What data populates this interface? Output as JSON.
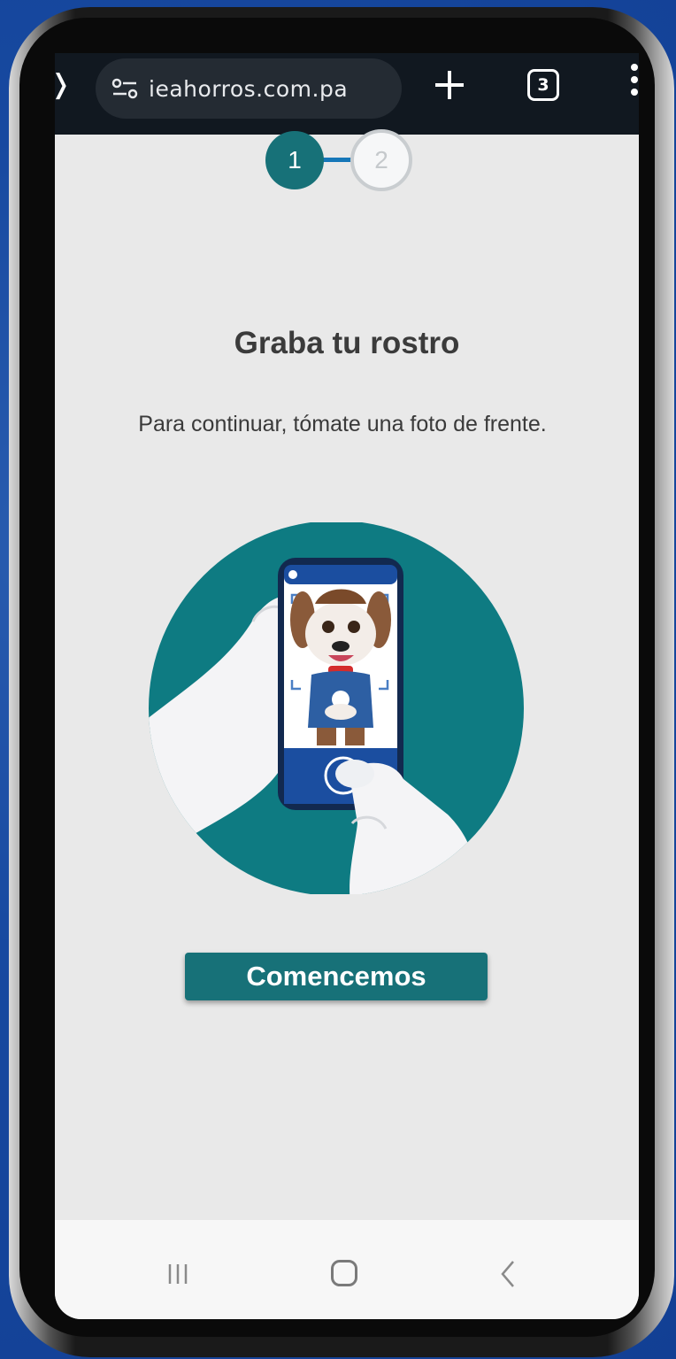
{
  "browser": {
    "url": "ieahorros.com.pa",
    "tab_count": "3",
    "icons": [
      "home-icon",
      "site-settings-icon",
      "plus-icon",
      "tab-switcher-icon",
      "more-vert-icon"
    ]
  },
  "stepper": {
    "steps": [
      "1",
      "2"
    ],
    "active_step": "1",
    "active_color": "#177178"
  },
  "page": {
    "title": "Graba tu rostro",
    "subtitle": "Para continuar, tómate una foto de frente.",
    "cta_label": "Comencemos"
  },
  "colors": {
    "accent": "#177178",
    "background": "#e9e9e9"
  }
}
